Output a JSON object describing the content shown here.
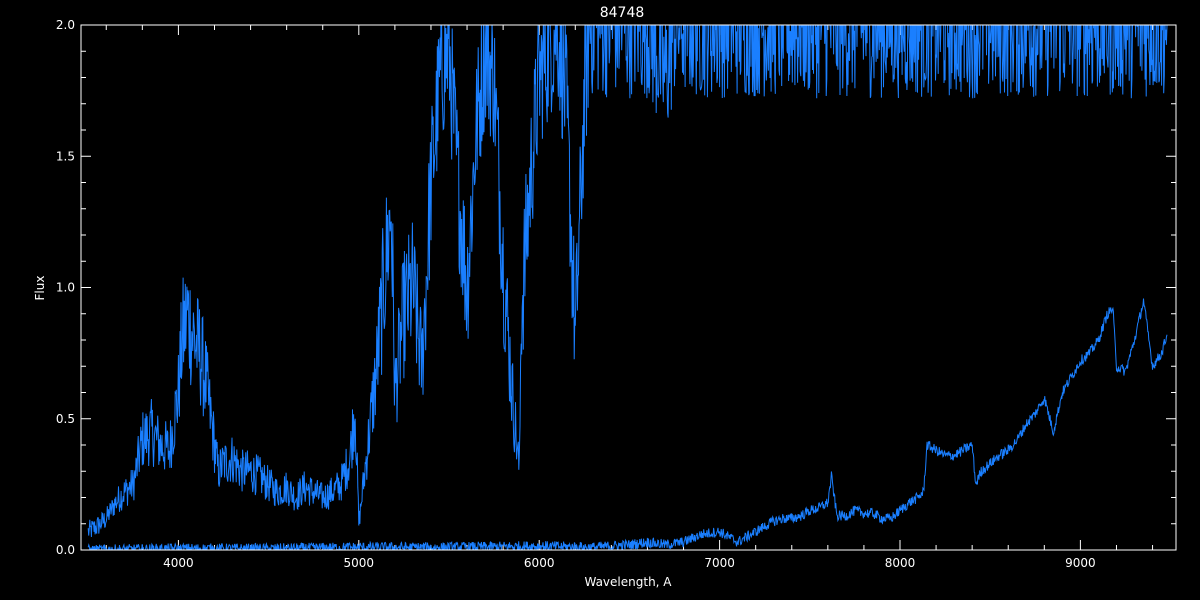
{
  "chart_data": {
    "type": "line",
    "title": "84748",
    "xlabel": "Wavelength, A",
    "ylabel": "Flux",
    "xlim": [
      3460,
      9530
    ],
    "ylim": [
      0,
      2.0
    ],
    "grid": false,
    "x_ticks": [
      4000,
      5000,
      6000,
      7000,
      8000,
      9000
    ],
    "x_tick_labels": [
      "4000",
      "5000",
      "6000",
      "7000",
      "8000",
      "9000"
    ],
    "y_ticks": [
      0,
      0.5,
      1.0,
      1.5,
      2.0
    ],
    "y_tick_labels": [
      "0.0",
      "0.5",
      "1.0",
      "1.5",
      "2.0"
    ],
    "series": [
      {
        "color": "#1a7fff",
        "role": "spectrum",
        "x": [
          3500,
          3550,
          3600,
          3650,
          3700,
          3750,
          3780,
          3800,
          3850,
          3900,
          3950,
          4000,
          4020,
          4050,
          4080,
          4100,
          4120,
          4150,
          4200,
          4220,
          4250,
          4300,
          4350,
          4400,
          4450,
          4500,
          4550,
          4600,
          4650,
          4700,
          4750,
          4800,
          4850,
          4900,
          4950,
          4980,
          5000,
          5050,
          5100,
          5150,
          5180,
          5200,
          5250,
          5300,
          5350,
          5400,
          5450,
          5500,
          5550,
          5600,
          5650,
          5700,
          5750,
          5800,
          5850,
          5890,
          5900,
          5950,
          6000,
          6050,
          6100,
          6150,
          6200,
          6250,
          6280,
          6300,
          6350,
          6400,
          6500,
          6600,
          6700,
          6750,
          6800,
          6850,
          6900,
          6950,
          7000,
          7050,
          7100,
          7150,
          7200,
          7250,
          7300,
          7350,
          7400,
          7450,
          7500,
          7550,
          7600,
          7620,
          7650,
          7700,
          7750,
          7800,
          7850,
          7900,
          7950,
          8000,
          8050,
          8100,
          8120,
          8150,
          8200,
          8250,
          8300,
          8350,
          8400,
          8420,
          8450,
          8500,
          8550,
          8600,
          8650,
          8700,
          8750,
          8800,
          8850,
          8900,
          8950,
          9000,
          9050,
          9100,
          9150,
          9180,
          9200,
          9250,
          9300,
          9350,
          9400,
          9450,
          9480
        ],
        "y": [
          0.07,
          0.09,
          0.12,
          0.18,
          0.22,
          0.25,
          0.35,
          0.42,
          0.45,
          0.4,
          0.38,
          0.6,
          0.8,
          0.9,
          0.82,
          0.78,
          0.75,
          0.65,
          0.4,
          0.3,
          0.33,
          0.35,
          0.3,
          0.3,
          0.28,
          0.25,
          0.22,
          0.24,
          0.2,
          0.24,
          0.22,
          0.2,
          0.22,
          0.25,
          0.35,
          0.55,
          0.1,
          0.4,
          0.7,
          1.1,
          1.3,
          0.6,
          0.9,
          1.0,
          0.7,
          1.4,
          1.8,
          1.9,
          1.4,
          1.0,
          1.6,
          1.9,
          1.8,
          1.1,
          0.6,
          0.3,
          0.9,
          1.4,
          1.8,
          1.9,
          2.0,
          1.7,
          0.8,
          1.7,
          2.0,
          2.0,
          2.0,
          2.0,
          2.0,
          2.0,
          1.8,
          2.0,
          2.0,
          2.0,
          2.0,
          2.0,
          2.0,
          2.0,
          2.0,
          2.0,
          2.0,
          2.0,
          2.0,
          2.0,
          2.0,
          2.0,
          2.0,
          2.0,
          2.0,
          2.0,
          2.0,
          2.0,
          2.0,
          2.0,
          2.0,
          2.0,
          2.0,
          2.0,
          2.0,
          2.0,
          2.0,
          2.0,
          2.0,
          2.0,
          2.0,
          2.0,
          2.0,
          2.0,
          2.0,
          2.0,
          2.0,
          2.0,
          2.0,
          2.0,
          2.0,
          2.0,
          2.0,
          2.0,
          2.0,
          2.0,
          2.0,
          2.0,
          2.0,
          2.0,
          2.0,
          2.0,
          2.0,
          2.0,
          2.0,
          2.0,
          2.0
        ]
      },
      {
        "color": "#1a7fff",
        "role": "low-continuum",
        "x": [
          3500,
          4000,
          4500,
          5000,
          5500,
          6000,
          6300,
          6500,
          6600,
          6700,
          6800,
          6900,
          7000,
          7050,
          7100,
          7150,
          7200,
          7250,
          7300,
          7350,
          7400,
          7450,
          7500,
          7550,
          7600,
          7620,
          7650,
          7700,
          7750,
          7800,
          7850,
          7900,
          7950,
          8000,
          8050,
          8100,
          8130,
          8150,
          8200,
          8250,
          8300,
          8350,
          8400,
          8420,
          8450,
          8500,
          8550,
          8600,
          8650,
          8700,
          8750,
          8800,
          8850,
          8900,
          8950,
          9000,
          9050,
          9100,
          9150,
          9180,
          9200,
          9250,
          9300,
          9350,
          9400,
          9450,
          9480
        ],
        "y": [
          0.0,
          0.005,
          0.005,
          0.01,
          0.01,
          0.015,
          0.01,
          0.02,
          0.03,
          0.02,
          0.03,
          0.06,
          0.07,
          0.05,
          0.03,
          0.05,
          0.07,
          0.09,
          0.11,
          0.12,
          0.12,
          0.13,
          0.15,
          0.16,
          0.18,
          0.28,
          0.13,
          0.13,
          0.15,
          0.14,
          0.14,
          0.12,
          0.12,
          0.15,
          0.18,
          0.2,
          0.22,
          0.4,
          0.38,
          0.36,
          0.36,
          0.38,
          0.4,
          0.25,
          0.3,
          0.33,
          0.36,
          0.38,
          0.42,
          0.48,
          0.52,
          0.58,
          0.45,
          0.6,
          0.66,
          0.72,
          0.75,
          0.8,
          0.9,
          0.92,
          0.7,
          0.68,
          0.8,
          0.95,
          0.7,
          0.75,
          0.82
        ]
      }
    ]
  }
}
